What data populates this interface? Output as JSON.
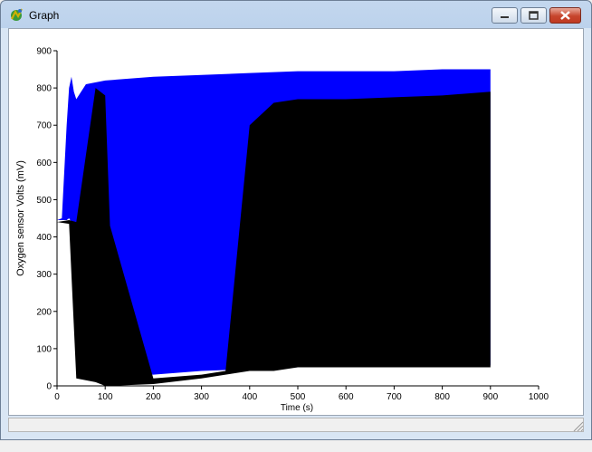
{
  "window": {
    "title": "Graph"
  },
  "icons": {
    "app": "graph-app-icon",
    "minimize": "minimize-icon",
    "maximize": "maximize-icon",
    "close": "close-icon",
    "grip": "resize-grip-icon"
  },
  "chart_data": {
    "type": "line",
    "title": "",
    "xlabel": "Time (s)",
    "ylabel": "Oxygen sensor Volts (mV)",
    "xlim": [
      0,
      1000
    ],
    "ylim": [
      0,
      900
    ],
    "xticks": [
      0,
      100,
      200,
      300,
      400,
      500,
      600,
      700,
      800,
      900,
      1000
    ],
    "yticks": [
      0,
      100,
      200,
      300,
      400,
      500,
      600,
      700,
      800,
      900
    ],
    "grid": false,
    "series": [
      {
        "color": "#0000ff",
        "style": "rapid oscillation band",
        "x": [
          0,
          10,
          20,
          25,
          30,
          35,
          40,
          60,
          100,
          200,
          300,
          400,
          500,
          600,
          700,
          800,
          900
        ],
        "upper": [
          445,
          450,
          700,
          800,
          830,
          790,
          770,
          810,
          820,
          830,
          835,
          840,
          845,
          845,
          845,
          850,
          850
        ],
        "lower": [
          445,
          445,
          445,
          450,
          440,
          300,
          150,
          80,
          40,
          30,
          40,
          45,
          50,
          55,
          55,
          55,
          55
        ]
      },
      {
        "color": "#000000",
        "style": "switching signal",
        "x": [
          0,
          25,
          40,
          80,
          100,
          110,
          200,
          300,
          350,
          400,
          450,
          500,
          600,
          700,
          800,
          900
        ],
        "upper": [
          440,
          445,
          440,
          800,
          780,
          430,
          20,
          30,
          40,
          700,
          760,
          770,
          770,
          775,
          780,
          790
        ],
        "lower": [
          440,
          435,
          20,
          10,
          0,
          0,
          5,
          20,
          30,
          40,
          40,
          50,
          50,
          50,
          50,
          50
        ]
      }
    ]
  }
}
